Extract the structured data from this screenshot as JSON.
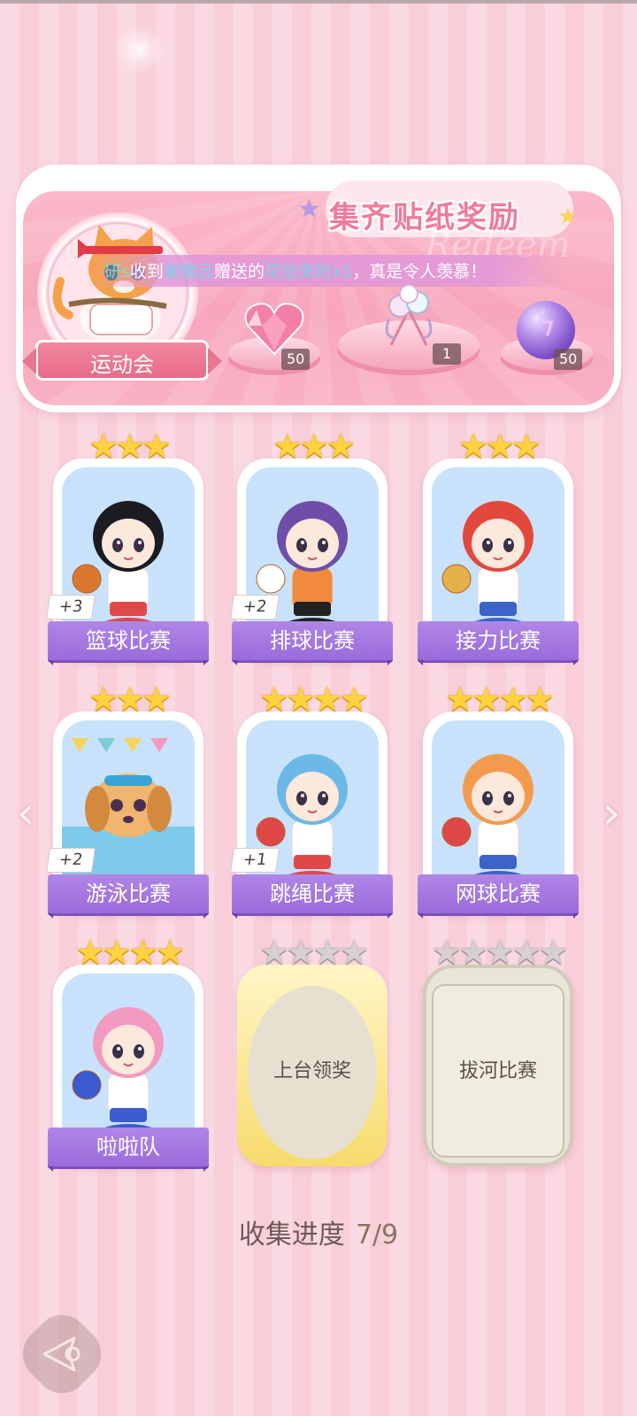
{
  "banner": {
    "title": "集齐贴纸奖励",
    "ghost_text": "Redeem",
    "event_label": "运动会",
    "notice": {
      "user": "研s",
      "text_1": "收到",
      "sender": "谢锦云",
      "text_2": "赠送的",
      "item": "花信来时x1",
      "text_3": "，真是令人羡慕！"
    },
    "rewards": [
      {
        "icon": "pink-heart-gem-icon",
        "qty": "50"
      },
      {
        "icon": "flower-bouquet-icon",
        "qty": "1"
      },
      {
        "icon": "purple-lightning-orb-icon",
        "qty": "50"
      }
    ]
  },
  "cards": [
    {
      "label": "篮球比赛",
      "stars": 3,
      "badge": "+3",
      "art": "basketball-girl"
    },
    {
      "label": "排球比赛",
      "stars": 3,
      "badge": "+2",
      "art": "volleyball-girl"
    },
    {
      "label": "接力比赛",
      "stars": 3,
      "badge": "",
      "art": "relay-girl"
    },
    {
      "label": "游泳比赛",
      "stars": 3,
      "badge": "+2",
      "art": "swimming-dog"
    },
    {
      "label": "跳绳比赛",
      "stars": 4,
      "badge": "+1",
      "art": "jumprope-girl"
    },
    {
      "label": "网球比赛",
      "stars": 4,
      "badge": "",
      "art": "tennis-girl"
    },
    {
      "label": "啦啦队",
      "stars": 4,
      "badge": "",
      "art": "cheerleader-girl"
    },
    {
      "label": "上台领奖",
      "stars": 4,
      "locked": true
    },
    {
      "label": "拔河比赛",
      "stars": 5,
      "locked": true
    }
  ],
  "progress": {
    "label": "收集进度",
    "value": "7/9"
  },
  "nav": {
    "left_icon": "chevron-left-icon",
    "right_icon": "chevron-right-icon",
    "back_icon": "back-arrow-icon"
  },
  "colors": {
    "accent_purple": "#9a6bdb",
    "banner_pink": "#f7a6bb",
    "star_gold": "#ffd23f"
  }
}
